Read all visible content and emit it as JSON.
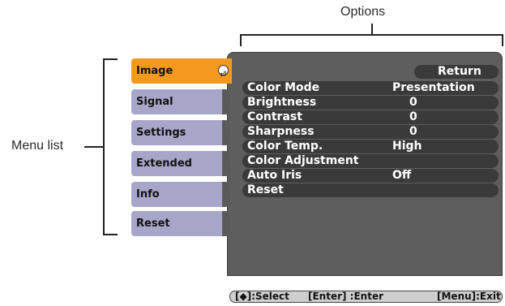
{
  "annotations": {
    "options": "Options",
    "menu_list": "Menu list"
  },
  "menu_tabs": [
    {
      "label": "Image",
      "active": true
    },
    {
      "label": "Signal",
      "active": false
    },
    {
      "label": "Settings",
      "active": false
    },
    {
      "label": "Extended",
      "active": false
    },
    {
      "label": "Info",
      "active": false
    },
    {
      "label": "Reset",
      "active": false
    }
  ],
  "options_panel": {
    "return_label": "Return",
    "rows": [
      {
        "label": "Color Mode",
        "value": "Presentation"
      },
      {
        "label": "Brightness",
        "value": "0"
      },
      {
        "label": "Contrast",
        "value": "0"
      },
      {
        "label": "Sharpness",
        "value": "0"
      },
      {
        "label": "Color Temp.",
        "value": "High"
      },
      {
        "label": "Color Adjustment",
        "value": ""
      },
      {
        "label": "Auto Iris",
        "value": "Off"
      },
      {
        "label": "Reset",
        "value": ""
      }
    ]
  },
  "status_bar": {
    "select": "[◆]:Select",
    "enter": "[Enter] :Enter",
    "exit": "[Menu]:Exit"
  },
  "colors": {
    "active_tab": "#f39a1e",
    "inactive_tab": "#a8a6c8",
    "panel": "#5e5e5e",
    "row": "#3a3a3a"
  }
}
